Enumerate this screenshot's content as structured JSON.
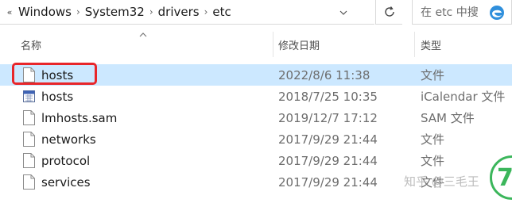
{
  "address_bar": {
    "overflow_glyph": "«",
    "path": [
      "Windows",
      "System32",
      "drivers",
      "etc"
    ],
    "separator": "›"
  },
  "search": {
    "placeholder": "在 etc 中搜"
  },
  "columns": {
    "name": "名称",
    "date": "修改日期",
    "type": "类型"
  },
  "files": [
    {
      "name": "hosts",
      "date": "2022/8/6 11:38",
      "type": "文件",
      "icon": "file-icon",
      "selected": true
    },
    {
      "name": "hosts",
      "date": "2018/7/25 10:35",
      "type": "iCalendar 文件",
      "icon": "calendar-file-icon",
      "selected": false
    },
    {
      "name": "lmhosts.sam",
      "date": "2019/12/7 17:12",
      "type": "SAM 文件",
      "icon": "file-icon",
      "selected": false
    },
    {
      "name": "networks",
      "date": "2017/9/29 21:44",
      "type": "文件",
      "icon": "file-icon",
      "selected": false
    },
    {
      "name": "protocol",
      "date": "2017/9/29 21:44",
      "type": "文件",
      "icon": "file-icon",
      "selected": false
    },
    {
      "name": "services",
      "date": "2017/9/29 21:44",
      "type": "文件",
      "icon": "file-icon",
      "selected": false
    }
  ],
  "watermark": {
    "text": "知乎 @三毛王",
    "badge": "7"
  },
  "colors": {
    "selection": "#cce8ff",
    "annotation_box": "#e8262a",
    "badge_green": "#3bb65b"
  }
}
